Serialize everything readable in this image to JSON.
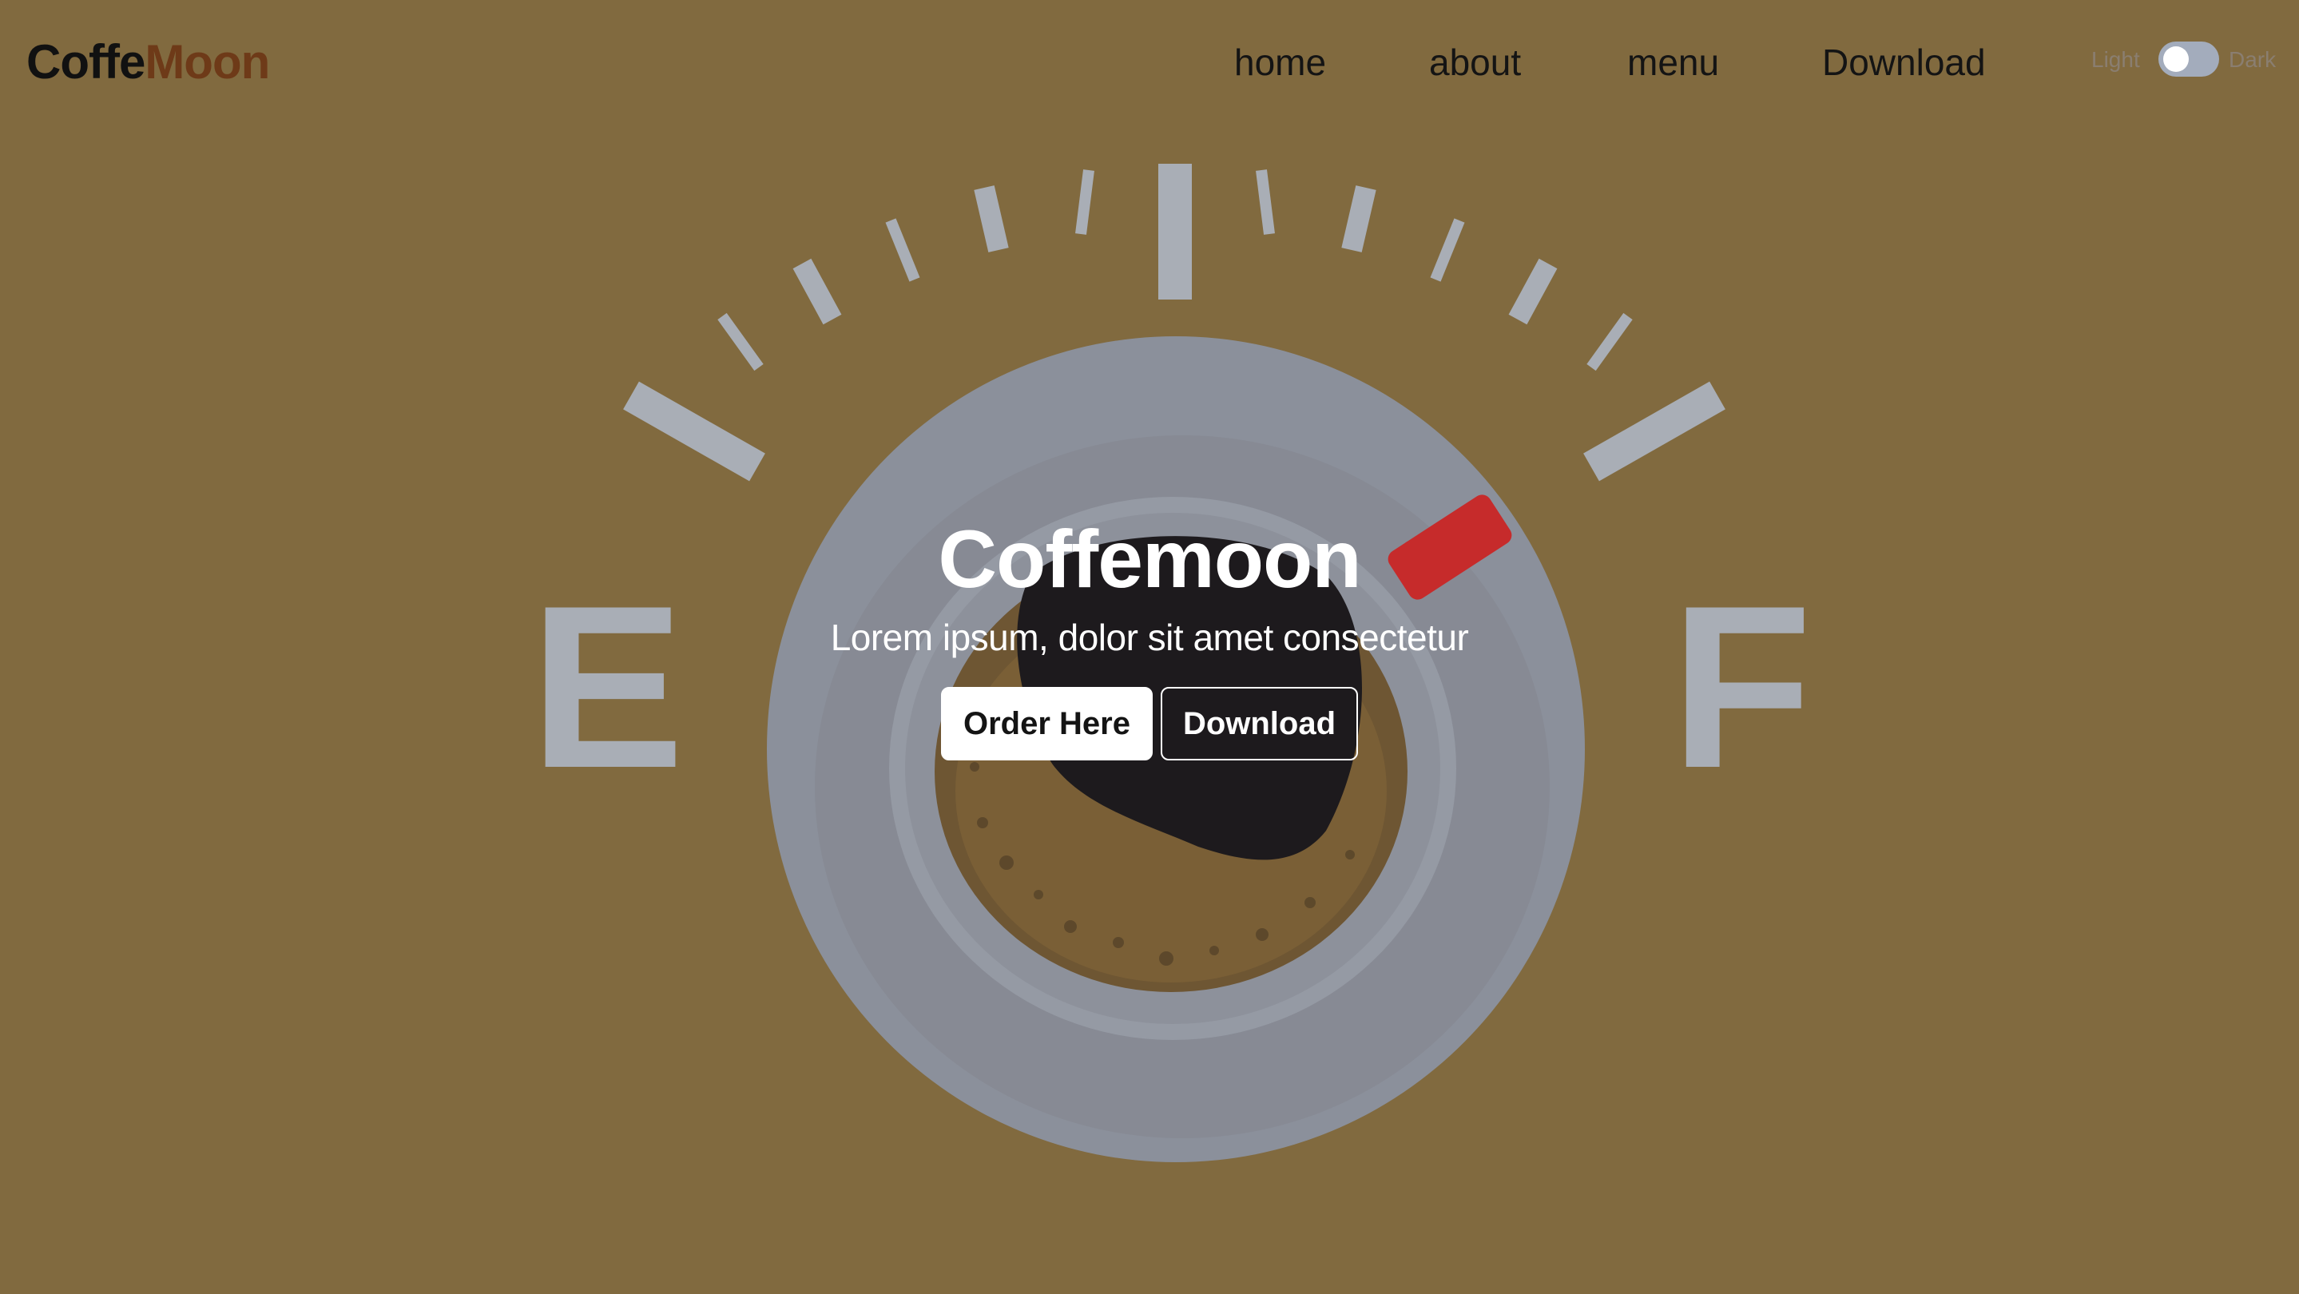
{
  "brand": {
    "logo_part1": "Coffe",
    "logo_part2": "Moon"
  },
  "nav": {
    "items": [
      {
        "label": "home"
      },
      {
        "label": "about"
      },
      {
        "label": "menu"
      },
      {
        "label": "Download"
      }
    ]
  },
  "theme_switch": {
    "light_label": "Light",
    "dark_label": "Dark",
    "selected": "Light"
  },
  "hero": {
    "title": "Coffemoon",
    "subtitle": "Lorem ipsum, dolor sit amet consectetur",
    "primary_button": "Order Here",
    "secondary_button": "Download",
    "gauge_empty_label": "E",
    "gauge_full_label": "F"
  },
  "colors": {
    "background": "#816a3f",
    "brand_accent": "#6e3a18",
    "needle": "#c62b2b"
  }
}
